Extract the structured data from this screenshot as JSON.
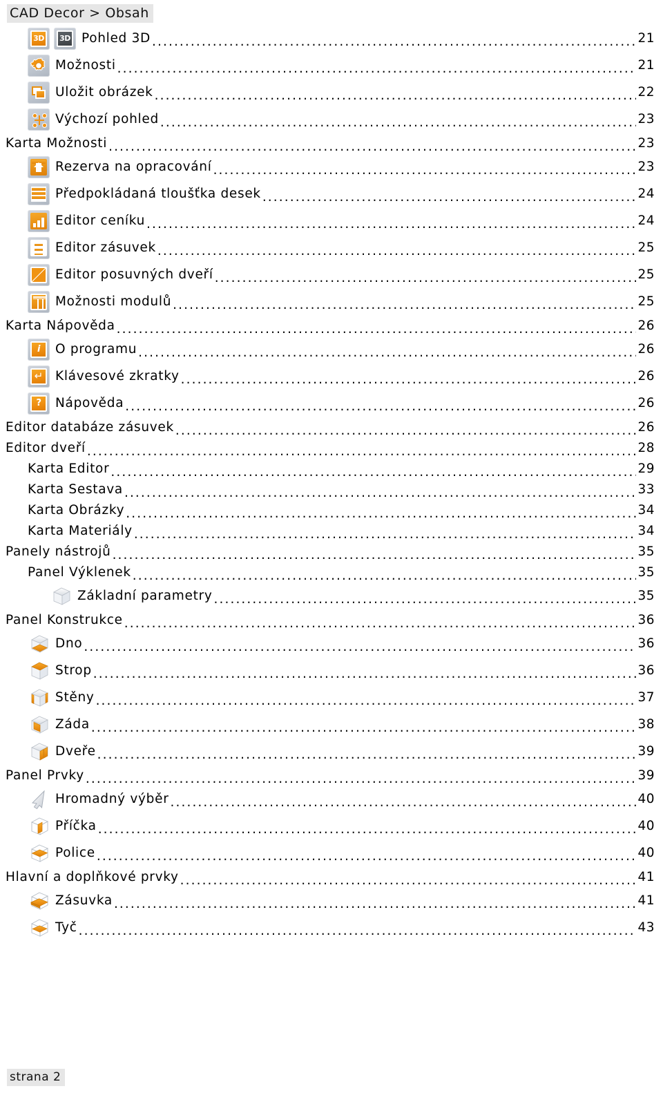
{
  "document": {
    "header": "CAD Decor > Obsah",
    "footer": "strana 2"
  },
  "toc": {
    "entries": [
      {
        "label": "Pohled 3D",
        "page": "21",
        "indent": 1,
        "icon": "view-3d-dual-icon"
      },
      {
        "label": "Možnosti",
        "page": "21",
        "indent": 1,
        "icon": "options-gear-icon"
      },
      {
        "label": "Uložit obrázek",
        "page": "22",
        "indent": 1,
        "icon": "save-image-icon"
      },
      {
        "label": "Výchozí pohled",
        "page": "23",
        "indent": 1,
        "icon": "default-view-icon"
      },
      {
        "label": "Karta Možnosti",
        "page": "23",
        "indent": 0,
        "icon": null
      },
      {
        "label": "Rezerva na opracování",
        "page": "23",
        "indent": 1,
        "icon": "machining-reserve-icon"
      },
      {
        "label": "Předpokládaná tloušťka desek",
        "page": "24",
        "indent": 1,
        "icon": "board-thickness-icon"
      },
      {
        "label": "Editor ceníku",
        "page": "24",
        "indent": 1,
        "icon": "price-list-editor-icon"
      },
      {
        "label": "Editor zásuvek",
        "page": "25",
        "indent": 1,
        "icon": "drawer-editor-icon"
      },
      {
        "label": "Editor posuvných dveří",
        "page": "25",
        "indent": 1,
        "icon": "sliding-door-editor-icon"
      },
      {
        "label": "Možnosti modulů",
        "page": "25",
        "indent": 1,
        "icon": "module-options-icon"
      },
      {
        "label": "Karta Nápověda",
        "page": "26",
        "indent": 0,
        "icon": null
      },
      {
        "label": "O programu",
        "page": "26",
        "indent": 1,
        "icon": "about-info-icon"
      },
      {
        "label": "Klávesové zkratky",
        "page": "26",
        "indent": 1,
        "icon": "keyboard-shortcuts-icon"
      },
      {
        "label": "Nápověda",
        "page": "26",
        "indent": 1,
        "icon": "help-question-icon"
      },
      {
        "label": "Editor databáze zásuvek",
        "page": "26",
        "indent": 0,
        "icon": null
      },
      {
        "label": "Editor dveří",
        "page": "28",
        "indent": 0,
        "icon": null
      },
      {
        "label": "Karta Editor",
        "page": "29",
        "indent": 1,
        "icon": null
      },
      {
        "label": "Karta Sestava",
        "page": "33",
        "indent": 1,
        "icon": null
      },
      {
        "label": "Karta Obrázky",
        "page": "34",
        "indent": 1,
        "icon": null
      },
      {
        "label": "Karta Materiály",
        "page": "34",
        "indent": 1,
        "icon": null
      },
      {
        "label": "Panely nástrojů",
        "page": "35",
        "indent": 0,
        "icon": null
      },
      {
        "label": "Panel Výklenek",
        "page": "35",
        "indent": 1,
        "icon": null
      },
      {
        "label": "Základní parametry",
        "page": "35",
        "indent": 2,
        "icon": "cabinet-basic-params-icon"
      },
      {
        "label": "Panel Konstrukce",
        "page": "36",
        "indent": 0,
        "icon": null
      },
      {
        "label": "Dno",
        "page": "36",
        "indent": 1,
        "icon": "cabinet-bottom-icon"
      },
      {
        "label": "Strop",
        "page": "36",
        "indent": 1,
        "icon": "cabinet-top-icon"
      },
      {
        "label": "Stěny",
        "page": "37",
        "indent": 1,
        "icon": "cabinet-sides-icon"
      },
      {
        "label": "Záda",
        "page": "38",
        "indent": 1,
        "icon": "cabinet-back-icon"
      },
      {
        "label": "Dveře",
        "page": "39",
        "indent": 1,
        "icon": "cabinet-doors-icon"
      },
      {
        "label": "Panel Prvky",
        "page": "39",
        "indent": 0,
        "icon": null
      },
      {
        "label": "Hromadný výběr",
        "page": "40",
        "indent": 1,
        "icon": "bulk-select-arrow-icon"
      },
      {
        "label": "Příčka",
        "page": "40",
        "indent": 1,
        "icon": "cabinet-divider-icon"
      },
      {
        "label": "Police",
        "page": "40",
        "indent": 1,
        "icon": "cabinet-shelf-icon"
      },
      {
        "label": "Hlavní a doplňkové prvky",
        "page": "41",
        "indent": 0,
        "icon": null
      },
      {
        "label": "Zásuvka",
        "page": "41",
        "indent": 1,
        "icon": "cabinet-drawer-icon"
      },
      {
        "label": "Tyč",
        "page": "43",
        "indent": 1,
        "icon": "cabinet-rod-icon"
      }
    ]
  },
  "colors": {
    "accent_orange": "#ef9214",
    "icon_plate_gray": "#bfc6cf",
    "dark_glyph": "#4a4f54",
    "highlight_bg": "#e6e6e6",
    "text": "#000000"
  }
}
